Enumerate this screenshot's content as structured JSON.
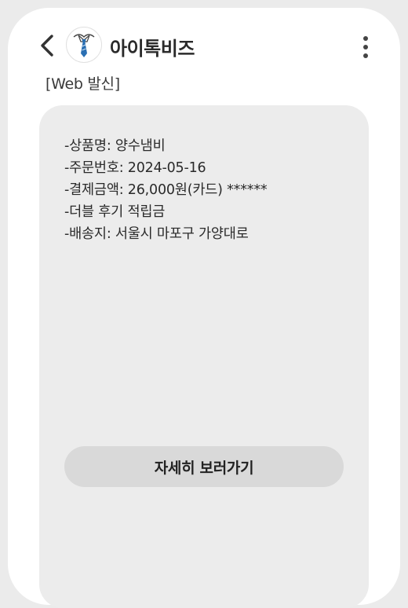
{
  "header": {
    "sender_name": "아이톡비즈",
    "back_icon": "chevron-left-icon",
    "avatar_icon": "necktie-logo-icon",
    "more_icon": "more-vertical-icon"
  },
  "tag": "[Web 발신]",
  "message": {
    "lines": [
      "-상품명: 양수냄비",
      "-주문번호: 2024-05-16",
      "-결제금액: 26,000원(카드) ******",
      "-더블 후기 적립금",
      "-배송지: 서울시 마포구 가양대로"
    ]
  },
  "cta": {
    "label": "자세히 보러가기"
  },
  "colors": {
    "tie_blue": "#2a6fb3",
    "bubble_gray": "#ececec",
    "button_gray": "#d9d9d9"
  }
}
